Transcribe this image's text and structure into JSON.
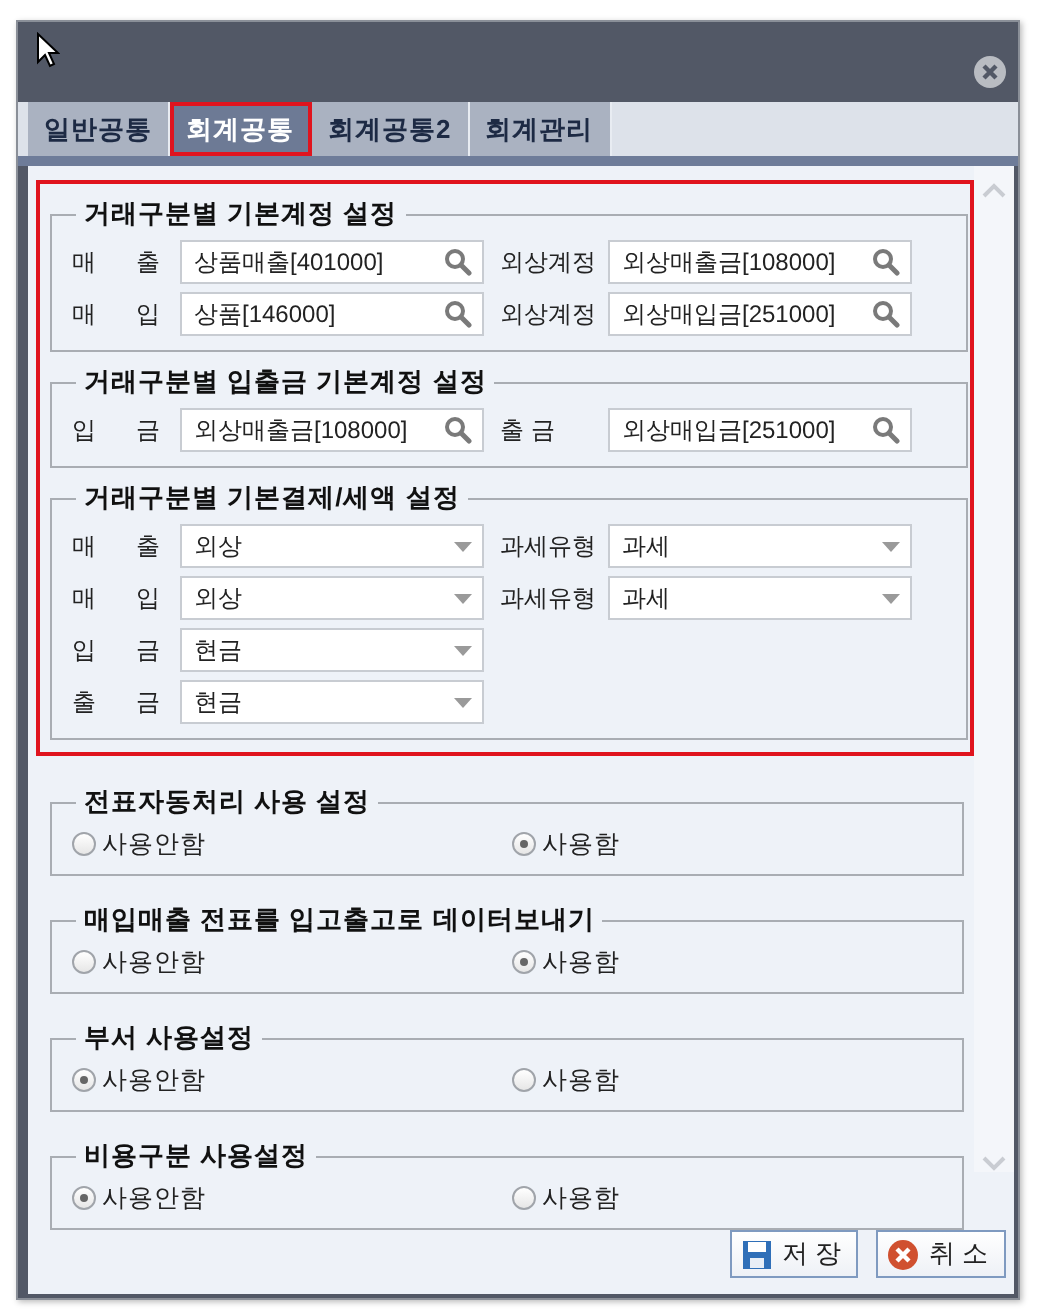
{
  "tabs": [
    {
      "label": "일반공통",
      "selected": false
    },
    {
      "label": "회계공통",
      "selected": true
    },
    {
      "label": "회계공통2",
      "selected": false
    },
    {
      "label": "회계관리",
      "selected": false
    }
  ],
  "account_sections": {
    "highlighted": true,
    "groups": [
      {
        "title": "거래구분별 기본계정 설정",
        "rows": [
          {
            "fields": [
              {
                "label": "매 출",
                "kind": "lookup",
                "value": "상품매출[401000]"
              },
              {
                "label": "외상계정",
                "kind": "lookup",
                "value": "외상매출금[108000]"
              }
            ]
          },
          {
            "fields": [
              {
                "label": "매 입",
                "kind": "lookup",
                "value": "상품[146000]"
              },
              {
                "label": "외상계정",
                "kind": "lookup",
                "value": "외상매입금[251000]"
              }
            ]
          }
        ]
      },
      {
        "title": "거래구분별 입출금 기본계정 설정",
        "rows": [
          {
            "fields": [
              {
                "label": "입 금",
                "kind": "lookup",
                "value": "외상매출금[108000]"
              },
              {
                "label": "출 금",
                "kind": "lookup",
                "value": "외상매입금[251000]"
              }
            ]
          }
        ]
      },
      {
        "title": "거래구분별 기본결제/세액 설정",
        "rows": [
          {
            "fields": [
              {
                "label": "매 출",
                "kind": "dropdown",
                "value": "외상"
              },
              {
                "label": "과세유형",
                "kind": "dropdown",
                "value": "과세"
              }
            ]
          },
          {
            "fields": [
              {
                "label": "매 입",
                "kind": "dropdown",
                "value": "외상"
              },
              {
                "label": "과세유형",
                "kind": "dropdown",
                "value": "과세"
              }
            ]
          },
          {
            "fields": [
              {
                "label": "입 금",
                "kind": "dropdown",
                "value": "현금"
              }
            ]
          },
          {
            "fields": [
              {
                "label": "출 금",
                "kind": "dropdown",
                "value": "현금"
              }
            ]
          }
        ]
      }
    ]
  },
  "usage_settings": [
    {
      "title": "전표자동처리 사용 설정",
      "options": [
        {
          "label": "사용안함",
          "selected": false
        },
        {
          "label": "사용함",
          "selected": true
        }
      ]
    },
    {
      "title": "매입매출 전표를 입고출고로 데이터보내기",
      "options": [
        {
          "label": "사용안함",
          "selected": false
        },
        {
          "label": "사용함",
          "selected": true
        }
      ]
    },
    {
      "title": "부서 사용설정",
      "options": [
        {
          "label": "사용안함",
          "selected": true
        },
        {
          "label": "사용함",
          "selected": false
        }
      ]
    },
    {
      "title": "비용구분 사용설정",
      "options": [
        {
          "label": "사용안함",
          "selected": true
        },
        {
          "label": "사용함",
          "selected": false
        }
      ]
    }
  ],
  "buttons": [
    {
      "label": "저 장",
      "kind": "save"
    },
    {
      "label": "취 소",
      "kind": "cancel"
    }
  ]
}
